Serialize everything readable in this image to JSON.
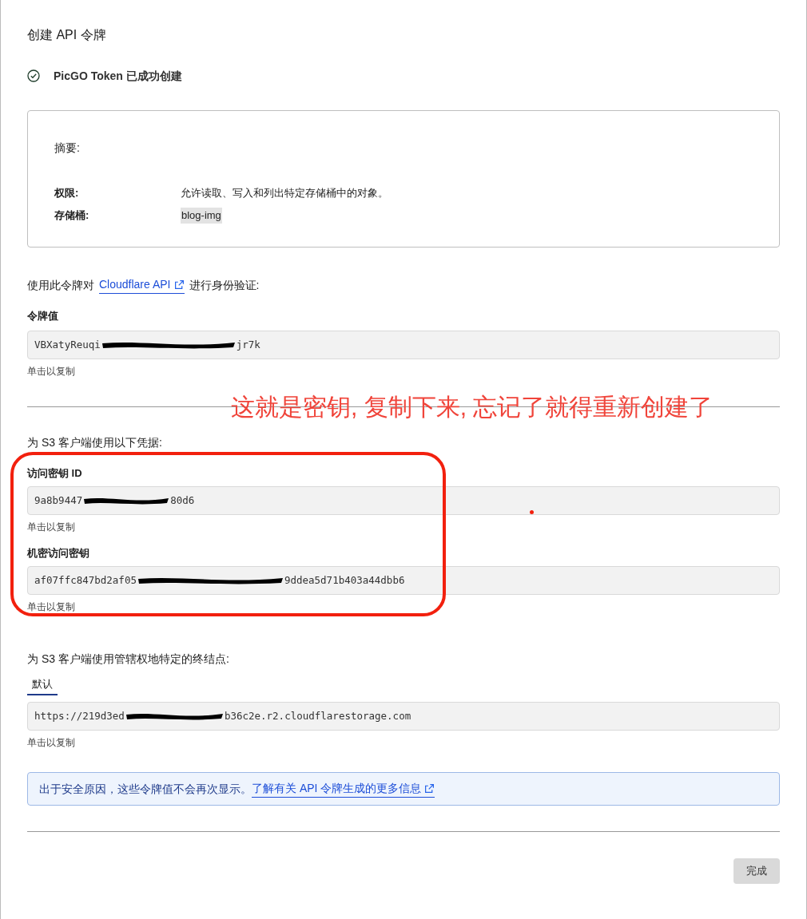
{
  "title": "创建 API 令牌",
  "success": {
    "message": "PicGO Token 已成功创建"
  },
  "summary": {
    "heading": "摘要:",
    "rows": [
      {
        "label": "权限:",
        "value": "允许读取、写入和列出特定存储桶中的对象。",
        "kind": "text"
      },
      {
        "label": "存储桶:",
        "value": "blog-img",
        "kind": "tag"
      }
    ]
  },
  "auth_intro": {
    "before": "使用此令牌对",
    "link": "Cloudflare API",
    "after": "进行身份验证:"
  },
  "token": {
    "label": "令牌值",
    "value_start": "VBXatyReuqi",
    "value_end": "jr7k",
    "hint": "单击以复制"
  },
  "s3_heading": "为 S3 客户端使用以下凭据:",
  "credentials": [
    {
      "label": "访问密钥 ID",
      "value_start": "9a8b9447",
      "value_end": "80d6",
      "hint": "单击以复制"
    },
    {
      "label": "机密访问密钥",
      "value_start": "af07ffc847bd2af05",
      "value_end": "9ddea5d71b403a44dbb6",
      "hint": "单击以复制"
    }
  ],
  "endpoint_heading": "为 S3 客户端使用管辖权地特定的终结点:",
  "endpoint_tabs": [
    {
      "label": "默认",
      "selected": true
    }
  ],
  "endpoint": {
    "value_start": "https://219d3ed",
    "value_end": "b36c2e.r2.cloudflarestorage.com",
    "hint": "单击以复制"
  },
  "notice": {
    "text": "出于安全原因，这些令牌值不会再次显示。",
    "link": "了解有关 API 令牌生成的更多信息"
  },
  "buttons": [
    "完成"
  ],
  "annotation": {
    "text": "这就是密钥, 复制下来, 忘记了就得重新创建了"
  }
}
